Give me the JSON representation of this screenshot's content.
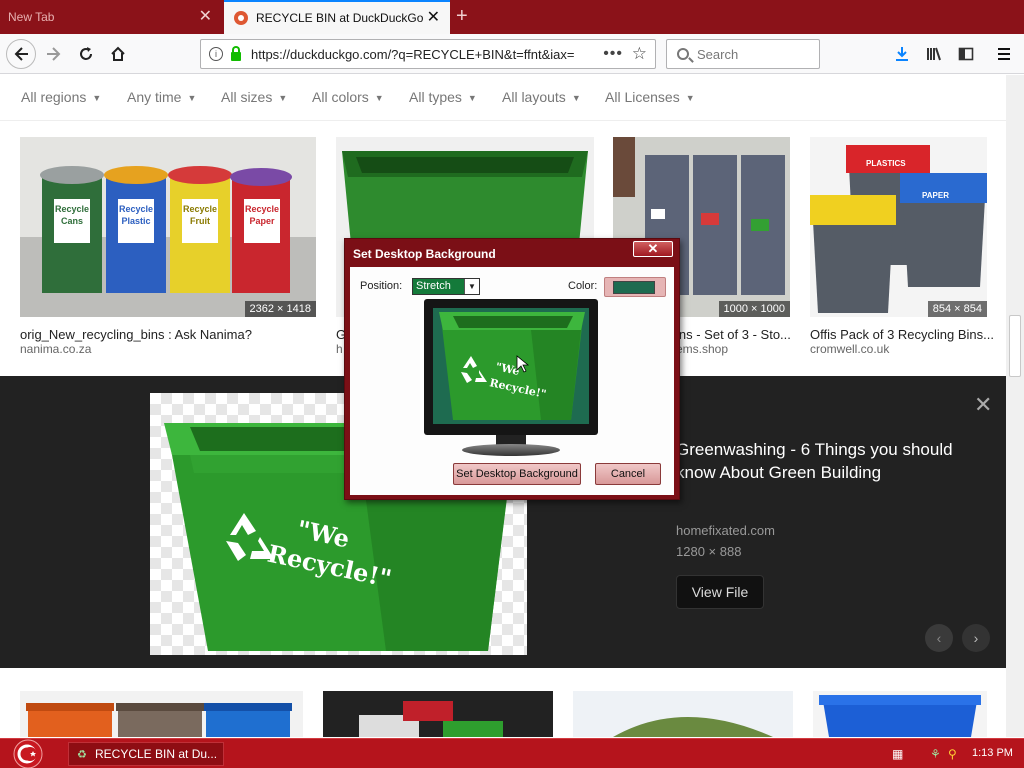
{
  "browser": {
    "tabs": [
      {
        "label": "New Tab",
        "active": false
      },
      {
        "label": "RECYCLE BIN at DuckDuckGo",
        "active": true
      }
    ],
    "url": "https://duckduckgo.com/?q=RECYCLE+BIN&t=ffnt&iax=",
    "search_placeholder": "Search",
    "icons": {
      "back": "back-arrow-icon",
      "forward": "forward-arrow-icon",
      "reload": "reload-icon",
      "home": "home-icon",
      "download": "download-icon",
      "library": "library-icon",
      "sidebar": "sidebar-icon",
      "menu": "hamburger-menu-icon"
    }
  },
  "filters": [
    "All regions",
    "Any time",
    "All sizes",
    "All colors",
    "All types",
    "All layouts",
    "All Licenses"
  ],
  "results": [
    {
      "title": "orig_New_recycling_bins : Ask Nanima?",
      "domain": "nanima.co.za",
      "dims": "2362 × 1418"
    },
    {
      "title": "G",
      "domain": "h",
      "dims": ""
    },
    {
      "title": "ins - Set of 3 - Sto...",
      "domain": "ems.shop",
      "dims": "1000 × 1000"
    },
    {
      "title": "Offis Pack of 3 Recycling Bins...",
      "domain": "cromwell.co.uk",
      "dims": "854 × 854"
    }
  ],
  "bin_labels": {
    "cans": "Recycle Cans",
    "plastic": "Recycle Plastic",
    "fruit": "Recycle Fruit",
    "paper": "Recycle Paper",
    "plastics_lid": "PLASTICS",
    "paper_lid": "PAPER"
  },
  "detail": {
    "title": "Greenwashing - 6 Things you should know About Green Building",
    "domain": "homefixated.com",
    "dims": "1280 × 888",
    "view_button": "View File",
    "image_text": "\"We Recycle!\""
  },
  "dialog": {
    "title": "Set Desktop Background",
    "close_label": "✕",
    "position_label": "Position:",
    "position_value": "Stretch",
    "color_label": "Color:",
    "color_value": "#1e6b50",
    "set_button": "Set Desktop Background",
    "cancel_button": "Cancel"
  },
  "taskbar": {
    "task_label": "RECYCLE BIN at Du...",
    "clock": "1:13 PM"
  },
  "colors": {
    "tab_strip": "#8b1219",
    "taskbar": "#b5141c",
    "bin_green": "#2e9e2e",
    "dialog_frame": "#7b0f16"
  }
}
